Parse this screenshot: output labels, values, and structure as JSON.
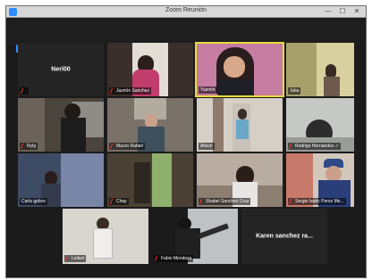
{
  "window": {
    "title": "Zoom Reunión"
  },
  "badge": {
    "glyph": "✋"
  },
  "controls": {
    "minimize": "—",
    "maximize": "☐",
    "close": "✕"
  },
  "participants": [
    {
      "name": "Neri00",
      "label": "",
      "video": false
    },
    {
      "name": "Jazmin Sanchez",
      "label": "Jazmín Sanchez",
      "video": true
    },
    {
      "name": "Yazmin",
      "label": "Yazmín",
      "video": true,
      "active": true
    },
    {
      "name": "Julia",
      "label": "Julia",
      "video": true
    },
    {
      "name": "Rylg",
      "label": "Rylg",
      "video": true
    },
    {
      "name": "Mauro Rafael",
      "label": "Mauro Rafael",
      "video": true
    },
    {
      "name": "Alison",
      "label": "Alison",
      "video": true
    },
    {
      "name": "Rodrigo Hernandez",
      "label": "Rodrigo Hernandez ✓",
      "video": true
    },
    {
      "name": "Carla gpbce",
      "label": "Carla gpbce",
      "video": true
    },
    {
      "name": "Chay",
      "label": "Chay",
      "video": true
    },
    {
      "name": "Shabel Sanchez Cruz",
      "label": "Shabel Sanchez Cruz",
      "video": true
    },
    {
      "name": "Sergio Isahc Perez Me...",
      "label": "Sergio Isahc Perez Me...",
      "video": true
    },
    {
      "name": "Leilani",
      "label": "Leilani",
      "video": true
    },
    {
      "name": "Fabio Mendoza",
      "label": "Fabio Mendoza",
      "video": true
    },
    {
      "name": "Karen sanchez ra...",
      "label": "",
      "video": false
    }
  ]
}
